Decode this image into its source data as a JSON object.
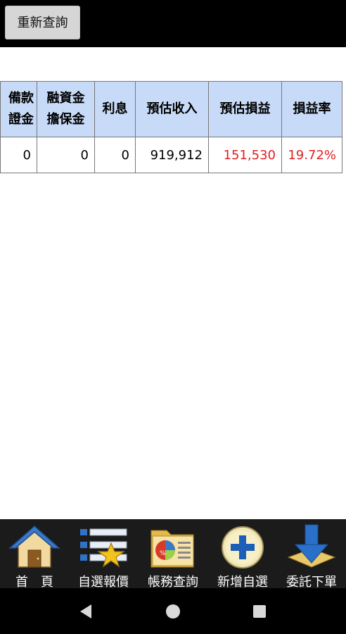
{
  "header": {
    "refresh_label": "重新查詢"
  },
  "table": {
    "columns": [
      [
        "備款",
        "證金"
      ],
      [
        "融資金",
        "擔保金"
      ],
      [
        "利息"
      ],
      [
        "預估收入"
      ],
      [
        "預估損益"
      ],
      [
        "損益率"
      ]
    ],
    "rows": [
      [
        "0",
        "0",
        "0",
        "919,912",
        "151,530",
        "19.72%"
      ]
    ],
    "highlight_color": "#e02020"
  },
  "tabs": [
    {
      "label": "首　頁",
      "icon": "house-icon"
    },
    {
      "label": "自選報價",
      "icon": "watchlist-star-icon"
    },
    {
      "label": "帳務查詢",
      "icon": "folder-chart-icon"
    },
    {
      "label": "新增自選",
      "icon": "add-plus-icon"
    },
    {
      "label": "委託下單",
      "icon": "order-download-icon"
    }
  ],
  "system_nav": [
    {
      "icon": "back-triangle-icon"
    },
    {
      "icon": "home-circle-icon"
    },
    {
      "icon": "recents-square-icon"
    }
  ]
}
